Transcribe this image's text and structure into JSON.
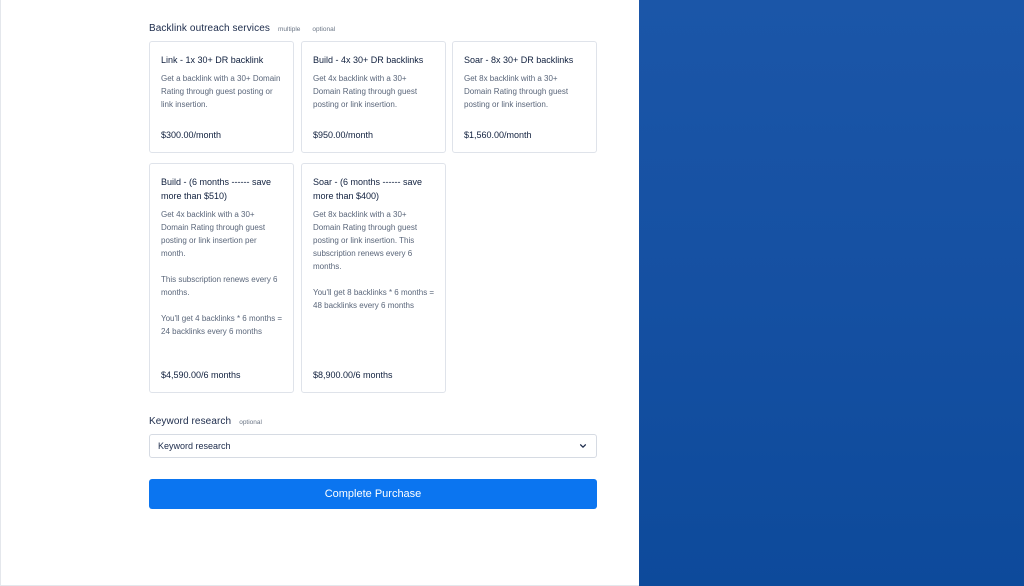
{
  "backlink": {
    "title": "Backlink outreach services",
    "tag_multiple": "multiple",
    "tag_optional": "optional",
    "cards": [
      {
        "title": "Link - 1x 30+ DR backlink",
        "desc": "Get a backlink with a 30+ Domain Rating through guest posting or link insertion.",
        "price": "$300.00/month"
      },
      {
        "title": "Build - 4x 30+ DR backlinks",
        "desc": "Get 4x backlink with a 30+ Domain Rating through guest posting or link insertion.",
        "price": "$950.00/month"
      },
      {
        "title": "Soar - 8x 30+ DR backlinks",
        "desc": "Get 8x backlink with a 30+ Domain Rating through guest posting or link insertion.",
        "price": "$1,560.00/month"
      },
      {
        "title": "Build - (6 months ------ save more than $510)",
        "desc": "Get 4x backlink with a 30+ Domain Rating through guest posting or link insertion per month.\n\nThis subscription renews every 6 months.\n\nYou'll get 4 backlinks * 6 months = 24 backlinks every 6 months",
        "price": "$4,590.00/6 months"
      },
      {
        "title": "Soar - (6 months ------ save more than $400)",
        "desc": "Get 8x backlink with a 30+ Domain Rating through guest posting or link insertion. This subscription renews every 6 months.\n\nYou'll get  8 backlinks * 6 months = 48 backlinks every 6 months",
        "price": "$8,900.00/6 months"
      }
    ]
  },
  "keyword": {
    "title": "Keyword research",
    "tag_optional": "optional",
    "selected": "Keyword research"
  },
  "actions": {
    "purchase_label": "Complete Purchase"
  },
  "icons": {
    "select_chevron": "chevron-down-icon"
  },
  "colors": {
    "primary_button": "#0b75f0",
    "side_panel": "#1550a2"
  }
}
